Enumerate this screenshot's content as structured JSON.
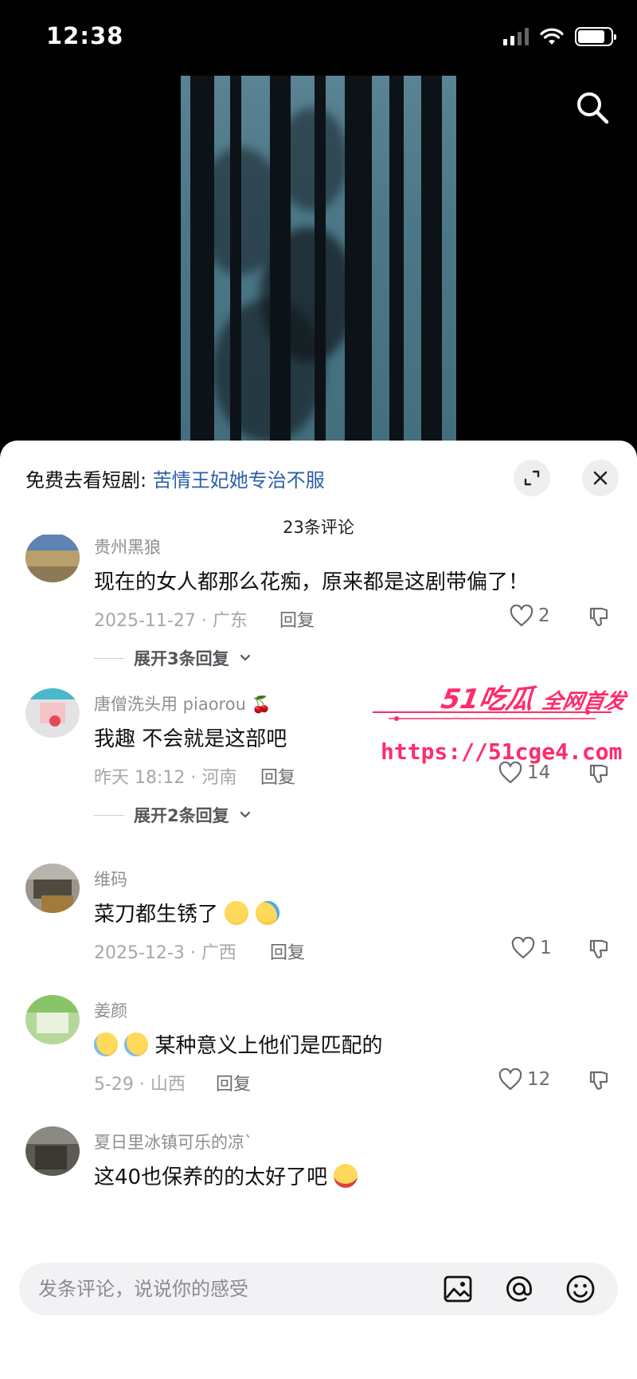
{
  "status_bar": {
    "time": "12:38"
  },
  "header": {
    "promo_prefix": "免费去看短剧: ",
    "promo_link": "苦情王妃她专治不服",
    "comment_count": "23条评论"
  },
  "comments": [
    {
      "username": "贵州黑狼",
      "text": "现在的女人都那么花痴，原来都是这剧带偏了！",
      "date_location": "2025-11-27 · 广东",
      "reply_label": "回复",
      "likes": "2",
      "expand_label": "展开3条回复"
    },
    {
      "username": "唐僧洗头用 piaorou",
      "username_emoji": "🍒",
      "text": "我趣 不会就是这部吧",
      "date_location": "昨天 18:12 · 河南",
      "reply_label": "回复",
      "likes": "14",
      "expand_label": "展开2条回复"
    },
    {
      "username": "维码",
      "text": "菜刀都生锈了",
      "date_location": "2025-12-3 · 广西",
      "reply_label": "回复",
      "likes": "1"
    },
    {
      "username": "姜颜",
      "text": "某种意义上他们是匹配的",
      "date_location": "5-29 · 山西",
      "reply_label": "回复",
      "likes": "12"
    },
    {
      "username": "夏日里冰镇可乐的凉`",
      "text": "这40也保养的的太好了吧"
    }
  ],
  "watermark": {
    "title": "51吃瓜",
    "subtitle": "全网首发",
    "url": "https://51cge4.com"
  },
  "input": {
    "placeholder": "发条评论，说说你的感受"
  },
  "icons": {
    "search": "search-icon",
    "expand": "expand-icon",
    "close": "close-icon",
    "image": "image-icon",
    "mention": "at-icon",
    "emoji": "emoji-icon",
    "like": "heart-icon",
    "dislike": "thumbs-down-icon"
  },
  "colors": {
    "link": "#2d5fa8",
    "watermark": "#ff2b6a",
    "panel_bg": "#ffffff",
    "screen_bg": "#000000"
  }
}
